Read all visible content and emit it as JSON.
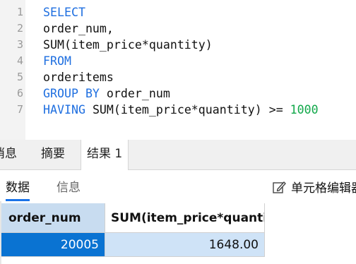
{
  "editor": {
    "lines": [
      {
        "no": "1",
        "parts": [
          {
            "t": "SELECT",
            "k": "kw"
          }
        ]
      },
      {
        "no": "2",
        "parts": [
          {
            "t": "order_num,",
            "k": "plain"
          }
        ]
      },
      {
        "no": "3",
        "parts": [
          {
            "t": "SUM(item_price*quantity)",
            "k": "plain"
          }
        ]
      },
      {
        "no": "4",
        "parts": [
          {
            "t": "FROM",
            "k": "kw"
          }
        ]
      },
      {
        "no": "5",
        "parts": [
          {
            "t": "orderitems",
            "k": "plain"
          }
        ]
      },
      {
        "no": "6",
        "parts": [
          {
            "t": "GROUP BY",
            "k": "kw"
          },
          {
            "t": " order_num",
            "k": "plain"
          }
        ]
      },
      {
        "no": "7",
        "parts": [
          {
            "t": "HAVING",
            "k": "kw"
          },
          {
            "t": " SUM(item_price*quantity) >= ",
            "k": "plain"
          },
          {
            "t": "1000",
            "k": "num"
          }
        ]
      }
    ]
  },
  "result_tabs": {
    "messages": "消息",
    "summary": "摘要",
    "result": "结果 1"
  },
  "subbar": {
    "data_tab": "数据",
    "info_tab": "信息",
    "edit_cell": "单元格编辑器"
  },
  "grid": {
    "columns": [
      "order_num",
      "SUM(item_price*quantity)"
    ],
    "rows": [
      [
        "20005",
        "1648.00"
      ]
    ]
  },
  "colors": {
    "keyword": "#1f6fe0",
    "number": "#11a84a",
    "selection": "#0a73d2"
  }
}
